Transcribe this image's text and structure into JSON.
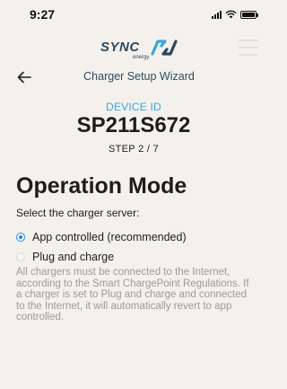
{
  "status_bar": {
    "time": "9:27",
    "icons": [
      "signal-icon",
      "wifi-icon",
      "battery-icon"
    ]
  },
  "brand": {
    "logo_text": "SYNC",
    "logo_subtext": "energy",
    "accent_color": "#3aa5d9",
    "primary_color": "#2c4a5e"
  },
  "header": {
    "title": "Charger Setup Wizard"
  },
  "device": {
    "label": "DEVICE ID",
    "id": "SP211S672"
  },
  "step": {
    "text": "STEP 2 / 7",
    "current": 2,
    "total": 7
  },
  "section": {
    "title": "Operation Mode",
    "subtitle": "Select the charger server:"
  },
  "options": [
    {
      "label": "App controlled (recommended)",
      "selected": true
    },
    {
      "label": "Plug and charge",
      "selected": false
    }
  ],
  "info": "All chargers must be connected to the Internet, according to the Smart ChargePoint Regulations. If a charger is set to Plug and charge and connected to the Internet, it will automatically revert to app controlled."
}
